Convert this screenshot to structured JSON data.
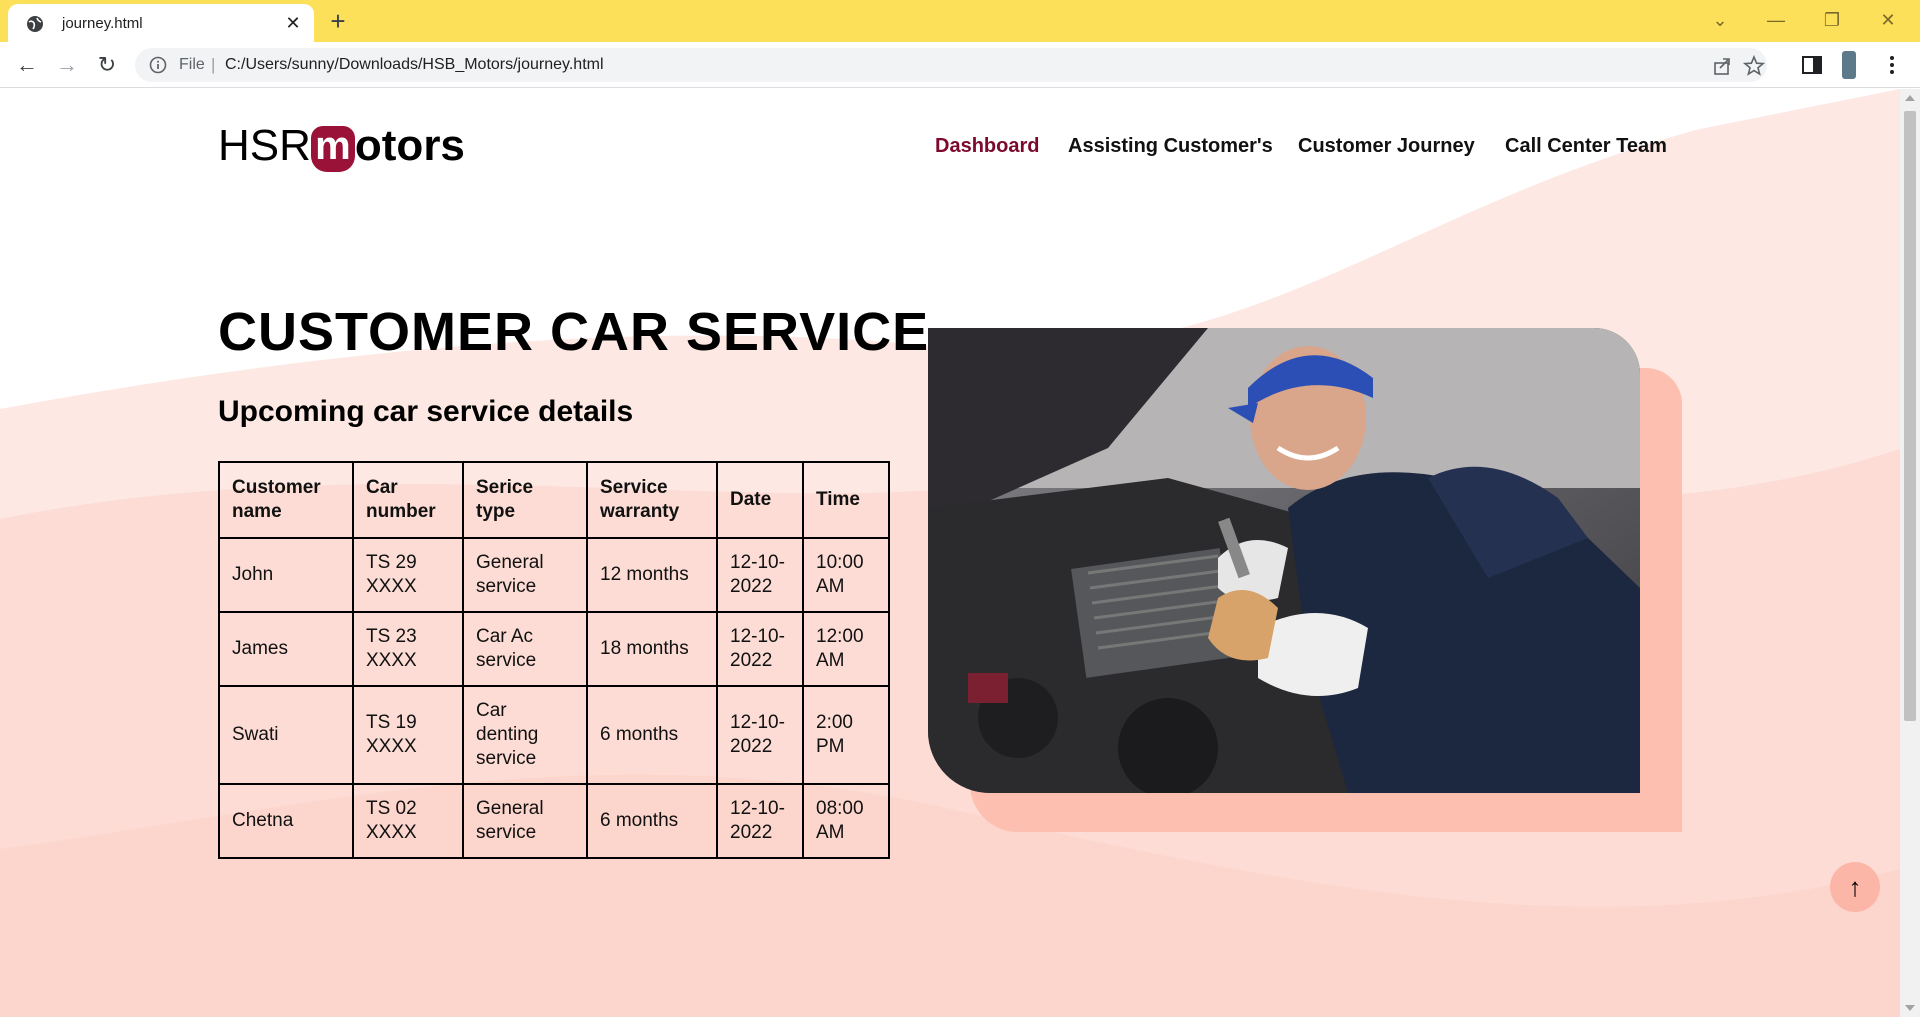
{
  "browser": {
    "tab_title": "journey.html",
    "tab_close": "✕",
    "new_tab": "+",
    "url_scheme": "File",
    "url_separator": "|",
    "url": "C:/Users/sunny/Downloads/HSB_Motors/journey.html",
    "window_buttons": {
      "chevron": "⌄",
      "minimize": "—",
      "restore": "❐",
      "close": "✕"
    },
    "back": "←",
    "forward": "→",
    "reload": "↻"
  },
  "site": {
    "logo": {
      "prefix": "HSR",
      "mark": "m",
      "suffix": "otors"
    },
    "nav": [
      {
        "label": "Dashboard",
        "active": true
      },
      {
        "label": "Assisting Customer's",
        "active": false
      },
      {
        "label": "Customer Journey",
        "active": false
      },
      {
        "label": "Call Center Team",
        "active": false
      }
    ],
    "heading": "CUSTOMER CAR SERVICE",
    "subheading": "Upcoming car service details",
    "table": {
      "headers": [
        "Customer name",
        "Car number",
        "Serice type",
        "Service warranty",
        "Date",
        "Time"
      ],
      "rows": [
        [
          "John",
          "TS 29 XXXX",
          "General service",
          "12 months",
          "12-10-2022",
          "10:00 AM"
        ],
        [
          "James",
          "TS 23 XXXX",
          "Car Ac service",
          "18 months",
          "12-10-2022",
          "12:00 AM"
        ],
        [
          "Swati",
          "TS 19 XXXX",
          "Car denting service",
          "6 months",
          "12-10-2022",
          "2:00 PM"
        ],
        [
          "Chetna",
          "TS 02 XXXX",
          "General service",
          "6 months",
          "12-10-2022",
          "08:00 AM"
        ]
      ]
    },
    "back_to_top": "↑"
  },
  "colors": {
    "browser_frame": "#fde05a",
    "brand": "#9b1238",
    "nav_active": "#7d0a2c",
    "wave_light": "#fde6e1",
    "wave_mid": "#fcd8d0",
    "accent_block": "#fcbfb0"
  },
  "icons": {
    "favicon": "globe-icon",
    "info": "info-icon",
    "share": "share-icon",
    "bookmark": "star-icon",
    "sidebar": "side-panel-icon",
    "profile": "profile-avatar",
    "menu": "kebab-menu-icon",
    "back_to_top": "arrow-up-icon"
  }
}
